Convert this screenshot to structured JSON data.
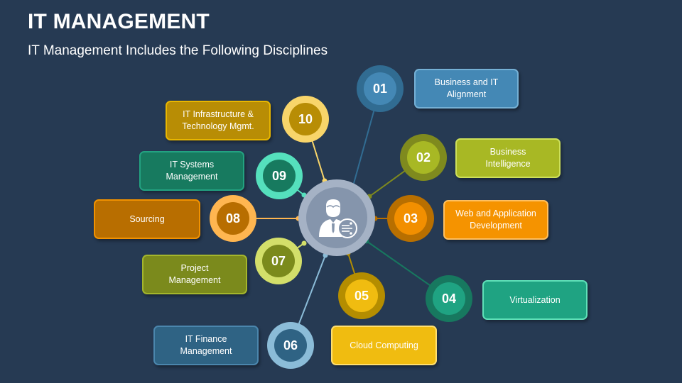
{
  "header": {
    "title": "IT MANAGEMENT",
    "subtitle": "IT Management Includes the Following Disciplines"
  },
  "hub": {
    "icon": "it-manager-person-icon",
    "colors": {
      "ring": "#a5b2c5",
      "fill": "#8595ac"
    }
  },
  "items": [
    {
      "number": "01",
      "label_lines": [
        "Business and IT",
        "Alignment"
      ],
      "label": "Business and IT Alignment",
      "colors": {
        "ring": "#316c92",
        "fill": "#4488b5",
        "box": "#4488b5",
        "box_border": "#75b0d5",
        "line": "#316c92"
      }
    },
    {
      "number": "02",
      "label_lines": [
        "Business",
        "Intelligence"
      ],
      "label": "Business Intelligence",
      "colors": {
        "ring": "#7f8a1e",
        "fill": "#a8b824",
        "box": "#a8b824",
        "box_border": "#cde05a",
        "line": "#7f8a1e"
      }
    },
    {
      "number": "03",
      "label_lines": [
        "Web and Application",
        "Development"
      ],
      "label": "Web and Application Development",
      "colors": {
        "ring": "#b86f00",
        "fill": "#f28f00",
        "box": "#f59300",
        "box_border": "#ffc060",
        "line": "#b86f00"
      }
    },
    {
      "number": "04",
      "label_lines": [
        "Virtualization"
      ],
      "label": "Virtualization",
      "colors": {
        "ring": "#17785f",
        "fill": "#1fa382",
        "box": "#1fa382",
        "box_border": "#5fe0b8",
        "line": "#17785f"
      }
    },
    {
      "number": "05",
      "label_lines": [
        "Cloud Computing"
      ],
      "label": "Cloud Computing",
      "colors": {
        "ring": "#b48d00",
        "fill": "#f0bc10",
        "box": "#f0bc10",
        "box_border": "#ffdf70",
        "line": "#b48d00"
      }
    },
    {
      "number": "06",
      "label_lines": [
        "IT Finance",
        "Management"
      ],
      "label": "IT Finance Management",
      "colors": {
        "ring": "#8bbcd8",
        "fill": "#2f6384",
        "box": "#2f6384",
        "box_border": "#4b86ad",
        "line": "#8bbcd8"
      }
    },
    {
      "number": "07",
      "label_lines": [
        "Project",
        "Management"
      ],
      "label": "Project Management",
      "colors": {
        "ring": "#d3df6a",
        "fill": "#7b8a1c",
        "box": "#7b8a1c",
        "box_border": "#a4b62c",
        "line": "#d3df6a"
      }
    },
    {
      "number": "08",
      "label_lines": [
        "Sourcing"
      ],
      "label": "Sourcing",
      "colors": {
        "ring": "#ffb650",
        "fill": "#b86e00",
        "box": "#b86e00",
        "box_border": "#f29200",
        "line": "#ffb650"
      }
    },
    {
      "number": "09",
      "label_lines": [
        "IT Systems",
        "Management"
      ],
      "label": "IT Systems Management",
      "colors": {
        "ring": "#55e0bd",
        "fill": "#177a5f",
        "box": "#177a5f",
        "box_border": "#23a281",
        "line": "#55e0bd"
      }
    },
    {
      "number": "10",
      "label_lines": [
        "IT Infrastructure &",
        "Technology Mgmt."
      ],
      "label": "IT Infrastructure & Technology Mgmt.",
      "colors": {
        "ring": "#f8d56a",
        "fill": "#b88d05",
        "box": "#b88d05",
        "box_border": "#e8b600",
        "line": "#f8d56a"
      }
    }
  ],
  "background_color": "#263a53"
}
